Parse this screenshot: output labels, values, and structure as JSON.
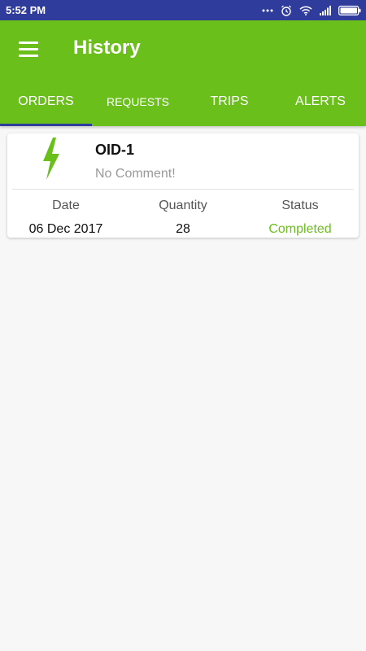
{
  "status_bar": {
    "time": "5:52 PM",
    "icons": [
      "more-dots-icon",
      "alarm-icon",
      "wifi-icon",
      "signal-icon",
      "battery-icon"
    ]
  },
  "app_bar": {
    "title": "History",
    "menu_icon": "hamburger-menu-icon"
  },
  "tabs": [
    {
      "label": "ORDERS",
      "active": true
    },
    {
      "label": "REQUESTS",
      "active": false
    },
    {
      "label": "TRIPS",
      "active": false
    },
    {
      "label": "ALERTS",
      "active": false
    }
  ],
  "orders": [
    {
      "icon": "lightning-bolt-icon",
      "id": "OID-1",
      "comment": "No Comment!",
      "columns": [
        {
          "header": "Date",
          "value": "06 Dec 2017"
        },
        {
          "header": "Quantity",
          "value": "28"
        },
        {
          "header": "Status",
          "value": "Completed"
        }
      ]
    }
  ],
  "colors": {
    "primary": "#6abf1b",
    "status_bar": "#2f3c9c",
    "tab_indicator": "#2f3c9c",
    "status_completed": "#6abf1b",
    "background": "#f7f7f7"
  }
}
